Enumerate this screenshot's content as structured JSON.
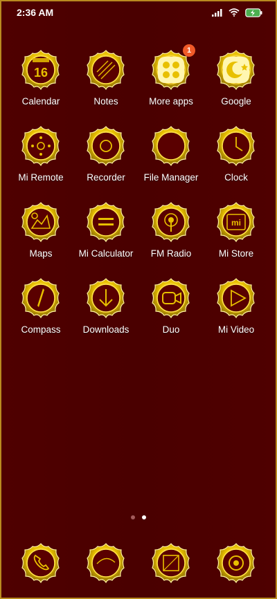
{
  "status_bar": {
    "time": "2:36 AM"
  },
  "apps": [
    {
      "label": "Calendar",
      "icon": "calendar-icon",
      "number": "16"
    },
    {
      "label": "Notes",
      "icon": "notes-icon"
    },
    {
      "label": "More apps",
      "icon": "more-apps-folder-icon",
      "badge": "1"
    },
    {
      "label": "Google",
      "icon": "google-icon"
    },
    {
      "label": "Mi Remote",
      "icon": "mi-remote-icon"
    },
    {
      "label": "Recorder",
      "icon": "recorder-icon"
    },
    {
      "label": "File Manager",
      "icon": "file-manager-icon"
    },
    {
      "label": "Clock",
      "icon": "clock-icon"
    },
    {
      "label": "Maps",
      "icon": "maps-icon"
    },
    {
      "label": "Mi Calculator",
      "icon": "calculator-icon"
    },
    {
      "label": "FM Radio",
      "icon": "fm-radio-icon"
    },
    {
      "label": "Mi Store",
      "icon": "mi-store-icon"
    },
    {
      "label": "Compass",
      "icon": "compass-icon"
    },
    {
      "label": "Downloads",
      "icon": "downloads-icon"
    },
    {
      "label": "Duo",
      "icon": "duo-icon"
    },
    {
      "label": "Mi Video",
      "icon": "mi-video-icon"
    }
  ],
  "dock": [
    {
      "icon": "phone-icon"
    },
    {
      "icon": "messages-icon"
    },
    {
      "icon": "browser-icon"
    },
    {
      "icon": "camera-icon"
    }
  ],
  "pager": {
    "pages": 2,
    "active": 1
  },
  "colors": {
    "background": "#4a0000",
    "gold": "#e8c000",
    "badge": "#f05a28"
  }
}
